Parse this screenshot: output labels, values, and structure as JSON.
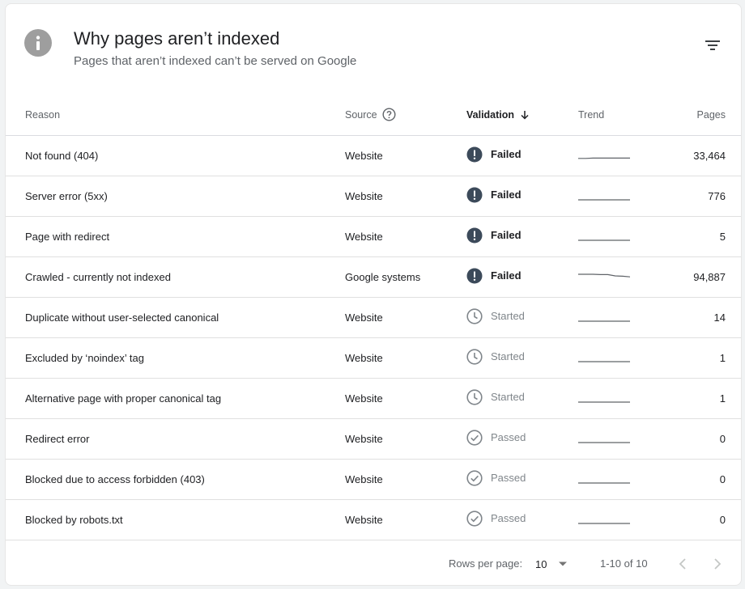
{
  "header": {
    "title": "Why pages aren’t indexed",
    "subtitle": "Pages that aren’t indexed can’t be served on Google"
  },
  "table": {
    "columns": {
      "reason": "Reason",
      "source": "Source",
      "validation": "Validation",
      "trend": "Trend",
      "pages": "Pages"
    },
    "rows": [
      {
        "reason": "Not found (404)",
        "source": "Website",
        "status": "failed",
        "validation": "Failed",
        "pages": "33,464",
        "trend": [
          0.15,
          0.15,
          0.2,
          0.2,
          0.2,
          0.2,
          0.2,
          0.2
        ]
      },
      {
        "reason": "Server error (5xx)",
        "source": "Website",
        "status": "failed",
        "validation": "Failed",
        "pages": "776",
        "trend": [
          0,
          0,
          0,
          0,
          0,
          0,
          0,
          0
        ]
      },
      {
        "reason": "Page with redirect",
        "source": "Website",
        "status": "failed",
        "validation": "Failed",
        "pages": "5",
        "trend": [
          0,
          0,
          0,
          0,
          0,
          0,
          0,
          0
        ]
      },
      {
        "reason": "Crawled - currently not indexed",
        "source": "Google systems",
        "status": "failed",
        "validation": "Failed",
        "pages": "94,887",
        "trend": [
          1,
          1,
          1,
          0.95,
          0.95,
          0.75,
          0.7,
          0.6
        ]
      },
      {
        "reason": "Duplicate without user-selected canonical",
        "source": "Website",
        "status": "started",
        "validation": "Started",
        "pages": "14",
        "trend": [
          0,
          0,
          0,
          0,
          0,
          0,
          0,
          0
        ]
      },
      {
        "reason": "Excluded by ‘noindex’ tag",
        "source": "Website",
        "status": "started",
        "validation": "Started",
        "pages": "1",
        "trend": [
          0,
          0,
          0,
          0,
          0,
          0,
          0,
          0
        ]
      },
      {
        "reason": "Alternative page with proper canonical tag",
        "source": "Website",
        "status": "started",
        "validation": "Started",
        "pages": "1",
        "trend": [
          0,
          0,
          0,
          0,
          0,
          0,
          0,
          0
        ]
      },
      {
        "reason": "Redirect error",
        "source": "Website",
        "status": "passed",
        "validation": "Passed",
        "pages": "0",
        "trend": [
          0,
          0,
          0,
          0,
          0,
          0,
          0,
          0
        ]
      },
      {
        "reason": "Blocked due to access forbidden (403)",
        "source": "Website",
        "status": "passed",
        "validation": "Passed",
        "pages": "0",
        "trend": [
          0,
          0,
          0,
          0,
          0,
          0,
          0,
          0
        ]
      },
      {
        "reason": "Blocked by robots.txt",
        "source": "Website",
        "status": "passed",
        "validation": "Passed",
        "pages": "0",
        "trend": [
          0,
          0,
          0,
          0,
          0,
          0,
          0,
          0
        ]
      }
    ]
  },
  "pagination": {
    "rows_per_page_label": "Rows per page:",
    "rows_per_page_value": "10",
    "range": "1-10 of 10"
  },
  "icons": {
    "header": "info-icon",
    "filter": "filter-icon",
    "source_help": "help-icon",
    "sort": "arrow-down-icon",
    "failed": "exclamation-circle-icon",
    "started": "clock-icon",
    "passed": "check-circle-icon",
    "dropdown": "dropdown-arrow-icon",
    "prev": "chevron-left-icon",
    "next": "chevron-right-icon"
  },
  "colors": {
    "failed_icon": "#3c4a5a",
    "muted": "#80868b",
    "trend_line": "#5f6368"
  }
}
